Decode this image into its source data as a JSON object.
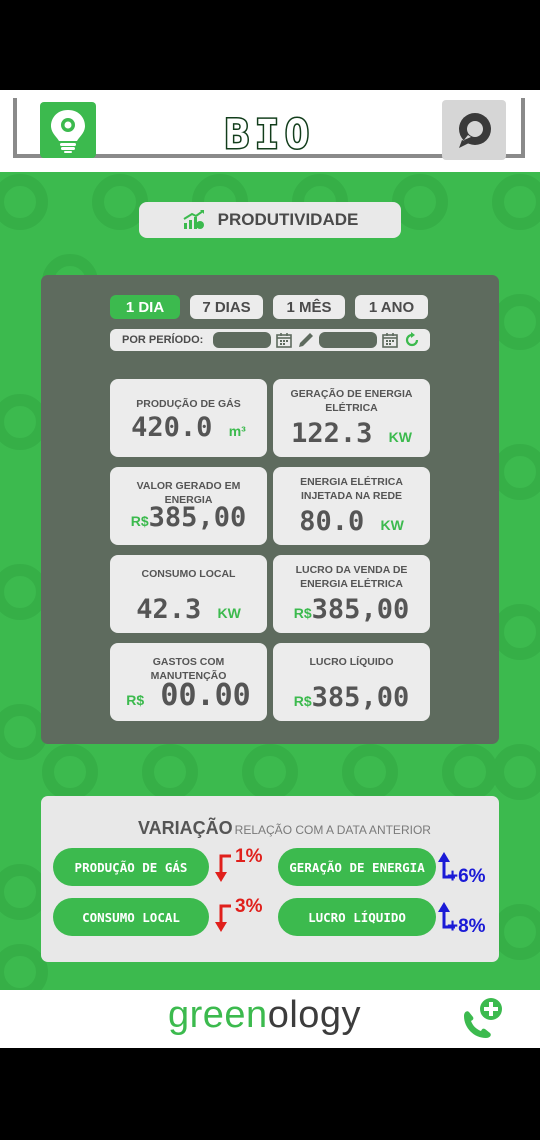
{
  "header": {
    "app_title": "BIO"
  },
  "productivity_label": "PRODUTIVIDADE",
  "tabs": [
    {
      "label": "1 DIA",
      "active": true
    },
    {
      "label": "7 DIAS",
      "active": false
    },
    {
      "label": "1 MÊS",
      "active": false
    },
    {
      "label": "1 ANO",
      "active": false
    }
  ],
  "period": {
    "label": "POR PERÍODO:"
  },
  "cards": [
    {
      "label": "PRODUÇÃO DE GÁS",
      "value": "420.0",
      "unit": "m³"
    },
    {
      "label": "GERAÇÃO DE ENERGIA ELÉTRICA",
      "value": "122.3",
      "unit": "KW"
    },
    {
      "label": "VALOR GERADO EM ENERGIA",
      "currency": "R$",
      "value": "385,00"
    },
    {
      "label": "ENERGIA ELÉTRICA INJETADA NA REDE",
      "value": "80.0",
      "unit": "KW"
    },
    {
      "label": "CONSUMO LOCAL",
      "value": "42.3",
      "unit": "KW"
    },
    {
      "label": "LUCRO DA VENDA DE ENERGIA ELÉTRICA",
      "currency": "R$",
      "value": "385,00"
    },
    {
      "label": "GASTOS COM MANUTENÇÃO",
      "currency": "R$",
      "value": "00.00"
    },
    {
      "label": "LUCRO LÍQUIDO",
      "currency": "R$",
      "value": "385,00"
    }
  ],
  "variation": {
    "title": "VARIAÇÃO",
    "subtitle": "RELAÇÃO COM A DATA ANTERIOR",
    "items": [
      {
        "label": "PRODUÇÃO DE GÁS",
        "delta": "1%",
        "direction": "down"
      },
      {
        "label": "GERAÇÃO DE ENERGIA",
        "delta": "+6%",
        "direction": "up"
      },
      {
        "label": "CONSUMO LOCAL",
        "delta": "3%",
        "direction": "down"
      },
      {
        "label": "LUCRO LÍQUIDO",
        "delta": "+8%",
        "direction": "up"
      }
    ]
  },
  "footer": {
    "brand_part1": "green",
    "brand_part2": "ology"
  },
  "colors": {
    "accent": "#3cba4e",
    "panel": "#5e6b5e",
    "down": "#e0201c",
    "up": "#1a1ad6"
  },
  "icons": [
    "lightbulb-icon",
    "chat-icon",
    "growth-chart-icon",
    "calendar-icon",
    "pencil-icon",
    "refresh-icon",
    "arrow-down-icon",
    "arrow-up-icon",
    "phone-plus-icon"
  ]
}
